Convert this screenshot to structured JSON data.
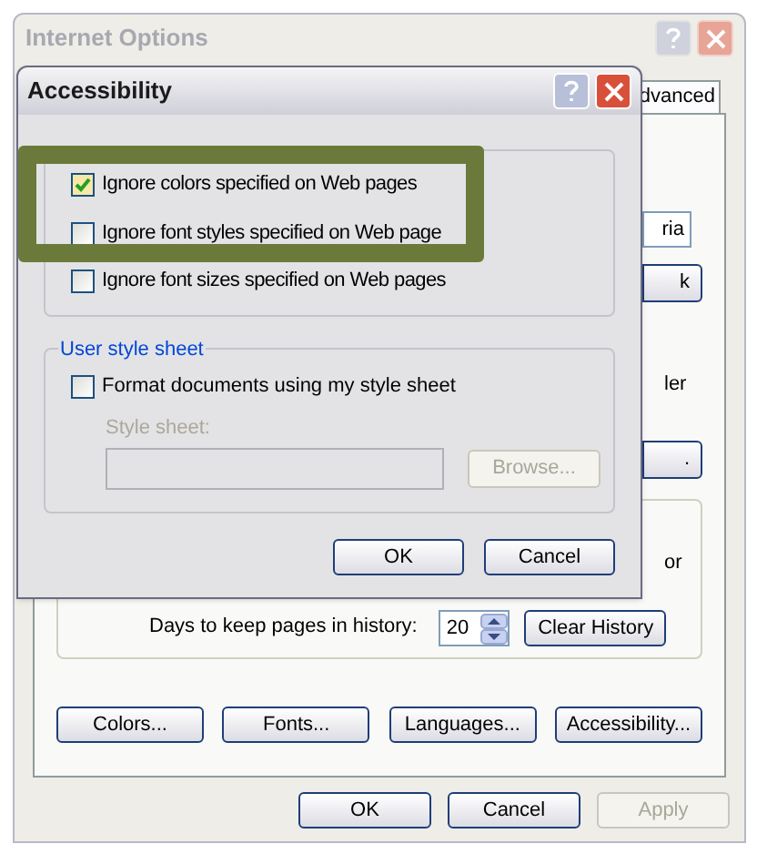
{
  "back_window": {
    "title": "Internet Options",
    "tab": {
      "label": "dvanced",
      "selected": true
    },
    "fragments": [
      {
        "kind": "field",
        "text": "ria"
      },
      {
        "kind": "button",
        "text": "k"
      },
      {
        "kind": "text",
        "text": "ler"
      },
      {
        "kind": "button",
        "text": "."
      },
      {
        "kind": "text",
        "text": "or"
      }
    ],
    "history": {
      "label": "Days to keep pages in history:",
      "days": "20",
      "button": "Clear History"
    },
    "buttons": [
      "Colors...",
      "Fonts...",
      "Languages...",
      "Accessibility..."
    ],
    "footer_buttons": [
      {
        "label": "OK",
        "disabled": false
      },
      {
        "label": "Cancel",
        "disabled": false
      },
      {
        "label": "Apply",
        "disabled": true
      }
    ]
  },
  "dialog": {
    "title": "Accessibility",
    "formatting_options": [
      {
        "label": "Ignore colors specified on Web pages",
        "checked": true
      },
      {
        "label": "Ignore font styles specified on Web page",
        "checked": false
      },
      {
        "label": "Ignore font sizes specified on Web pages",
        "checked": false
      }
    ],
    "user_style_sheet": {
      "legend": "User style sheet",
      "option": {
        "label": "Format documents using my style sheet",
        "checked": false
      },
      "field_label": "Style sheet:",
      "browse": {
        "label": "Browse...",
        "disabled": true
      }
    },
    "buttons": [
      "OK",
      "Cancel"
    ]
  }
}
